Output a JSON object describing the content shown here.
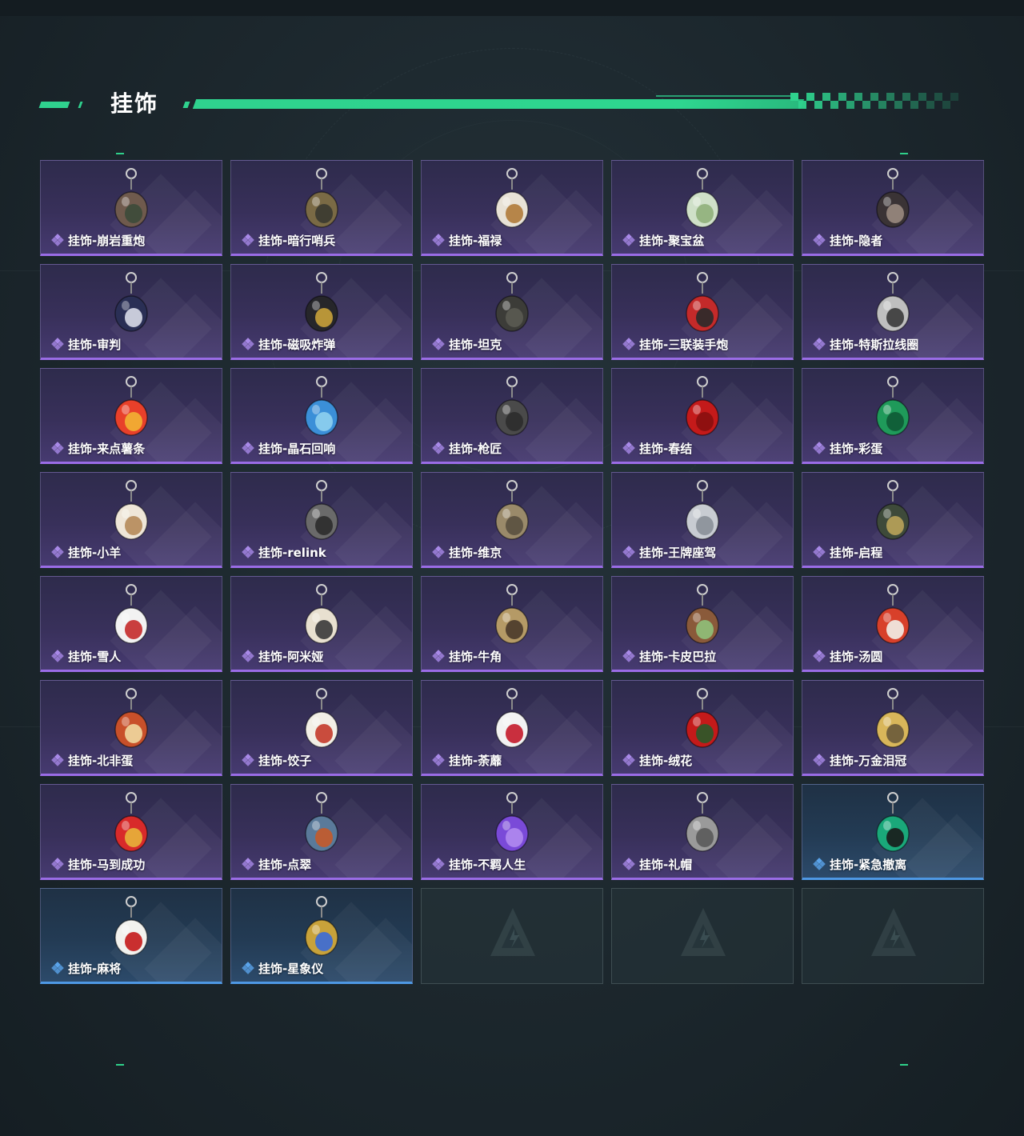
{
  "section": {
    "title": "挂饰"
  },
  "colors": {
    "accent": "#2fd28e",
    "purple_border": "#9a6ce6",
    "blue_border": "#4e98e4",
    "purple_rarity": "#a889e8",
    "blue_rarity": "#5aa3ea"
  },
  "items": [
    {
      "label": "挂饰-崩岩重炮",
      "rarity": "purple",
      "icon": "rock-gunner-charm",
      "c1": "#6f5a4d",
      "c2": "#3c4a3a"
    },
    {
      "label": "挂饰-暗行哨兵",
      "rarity": "purple",
      "icon": "sentry-soldier-charm",
      "c1": "#7a6a45",
      "c2": "#3a3a30"
    },
    {
      "label": "挂饰-福禄",
      "rarity": "purple",
      "icon": "gourd-charm",
      "c1": "#e8e2d6",
      "c2": "#b07b3a"
    },
    {
      "label": "挂饰-聚宝盆",
      "rarity": "purple",
      "icon": "treasure-bowl-charm",
      "c1": "#cfe0c8",
      "c2": "#8fb07a"
    },
    {
      "label": "挂饰-隐者",
      "rarity": "purple",
      "icon": "hermit-card-charm",
      "c1": "#3a3335",
      "c2": "#9a8a80"
    },
    {
      "label": "挂饰-审判",
      "rarity": "purple",
      "icon": "judgement-card-charm",
      "c1": "#2a2f55",
      "c2": "#d8dbe8"
    },
    {
      "label": "挂饰-磁吸炸弹",
      "rarity": "purple",
      "icon": "magnetic-bomb-charm",
      "c1": "#26262a",
      "c2": "#c9a23a"
    },
    {
      "label": "挂饰-坦克",
      "rarity": "purple",
      "icon": "tank-charm",
      "c1": "#3c3c38",
      "c2": "#5a5a52"
    },
    {
      "label": "挂饰-三联装手炮",
      "rarity": "purple",
      "icon": "hand-cannon-charm",
      "c1": "#c42a2a",
      "c2": "#2a2a2a"
    },
    {
      "label": "挂饰-特斯拉线圈",
      "rarity": "purple",
      "icon": "tesla-coil-charm",
      "c1": "#bfbfbf",
      "c2": "#3a3a3a"
    },
    {
      "label": "挂饰-来点薯条",
      "rarity": "purple",
      "icon": "fries-charm",
      "c1": "#e8402a",
      "c2": "#f2b233"
    },
    {
      "label": "挂饰-晶石回响",
      "rarity": "purple",
      "icon": "crystal-charm",
      "c1": "#3b8fd8",
      "c2": "#8fd0f0"
    },
    {
      "label": "挂饰-枪匠",
      "rarity": "purple",
      "icon": "gunsmith-box-charm",
      "c1": "#4a4a4a",
      "c2": "#2c2c2c"
    },
    {
      "label": "挂饰-春结",
      "rarity": "purple",
      "icon": "chinese-knot-charm",
      "c1": "#c41a1a",
      "c2": "#8a1010"
    },
    {
      "label": "挂饰-彩蛋",
      "rarity": "purple",
      "icon": "easter-egg-charm",
      "c1": "#1f9a5a",
      "c2": "#0e5a35"
    },
    {
      "label": "挂饰-小羊",
      "rarity": "purple",
      "icon": "lamb-charm",
      "c1": "#efe6d8",
      "c2": "#b58a5a"
    },
    {
      "label": "挂饰-relink",
      "rarity": "purple",
      "icon": "relink-emblem-charm",
      "c1": "#6a6a6a",
      "c2": "#2c2c2c"
    },
    {
      "label": "挂饰-维京",
      "rarity": "purple",
      "icon": "viking-hammer-charm",
      "c1": "#9a8a6a",
      "c2": "#5a5040"
    },
    {
      "label": "挂饰-王牌座驾",
      "rarity": "purple",
      "icon": "jet-plane-charm",
      "c1": "#c8ccd2",
      "c2": "#8a9098"
    },
    {
      "label": "挂饰-启程",
      "rarity": "purple",
      "icon": "departure-badge-charm",
      "c1": "#3e4a3a",
      "c2": "#b9a35a"
    },
    {
      "label": "挂饰-雪人",
      "rarity": "purple",
      "icon": "snowman-charm",
      "c1": "#f2f2f2",
      "c2": "#c42a2a"
    },
    {
      "label": "挂饰-阿米娅",
      "rarity": "purple",
      "icon": "amiya-bunny-charm",
      "c1": "#e8e0d0",
      "c2": "#3a3a3a"
    },
    {
      "label": "挂饰-牛角",
      "rarity": "purple",
      "icon": "bull-horns-charm",
      "c1": "#b59a66",
      "c2": "#4a3a2a"
    },
    {
      "label": "挂饰-卡皮巴拉",
      "rarity": "purple",
      "icon": "capybara-charm",
      "c1": "#8a5a3a",
      "c2": "#8fc07a"
    },
    {
      "label": "挂饰-汤圆",
      "rarity": "purple",
      "icon": "tangyuan-bowl-charm",
      "c1": "#d8402a",
      "c2": "#f2efe8"
    },
    {
      "label": "挂饰-北非蛋",
      "rarity": "purple",
      "icon": "shakshuka-pan-charm",
      "c1": "#c8502a",
      "c2": "#f0d8a0"
    },
    {
      "label": "挂饰-饺子",
      "rarity": "purple",
      "icon": "dumplings-plate-charm",
      "c1": "#f2efe6",
      "c2": "#c43a2a"
    },
    {
      "label": "挂饰-荼蘼",
      "rarity": "purple",
      "icon": "flower-fairy-charm",
      "c1": "#f2f2f2",
      "c2": "#c41a2a"
    },
    {
      "label": "挂饰-绒花",
      "rarity": "purple",
      "icon": "velvet-flower-charm",
      "c1": "#c41a1a",
      "c2": "#2a5a2a"
    },
    {
      "label": "挂饰-万金泪冠",
      "rarity": "purple",
      "icon": "golden-crown-charm",
      "c1": "#d8b65a",
      "c2": "#6a5a3a"
    },
    {
      "label": "挂饰-马到成功",
      "rarity": "purple",
      "icon": "red-horse-charm",
      "c1": "#d82a2a",
      "c2": "#e8b23a"
    },
    {
      "label": "挂饰-点翠",
      "rarity": "purple",
      "icon": "kingfisher-hairpin-charm",
      "c1": "#5a7a9a",
      "c2": "#c45a2a"
    },
    {
      "label": "挂饰-不羁人生",
      "rarity": "purple",
      "icon": "sneaker-charm",
      "c1": "#7a4ad8",
      "c2": "#b08af0"
    },
    {
      "label": "挂饰-礼帽",
      "rarity": "purple",
      "icon": "fedora-hat-charm",
      "c1": "#9a9a9a",
      "c2": "#5a5a5a"
    },
    {
      "label": "挂饰-紧急撤离",
      "rarity": "blue",
      "icon": "emergency-exit-charm",
      "c1": "#1aa87a",
      "c2": "#1a1a1a"
    },
    {
      "label": "挂饰-麻将",
      "rarity": "blue",
      "icon": "mahjong-tile-charm",
      "c1": "#f2f2ee",
      "c2": "#c41a1a"
    },
    {
      "label": "挂饰-星象仪",
      "rarity": "blue",
      "icon": "astrolabe-charm",
      "c1": "#c8a23a",
      "c2": "#3a6ad8"
    }
  ],
  "empty_slots": [
    {
      "icon": "game-logo-placeholder-icon"
    },
    {
      "icon": "game-logo-placeholder-icon"
    },
    {
      "icon": "game-logo-placeholder-icon"
    }
  ]
}
